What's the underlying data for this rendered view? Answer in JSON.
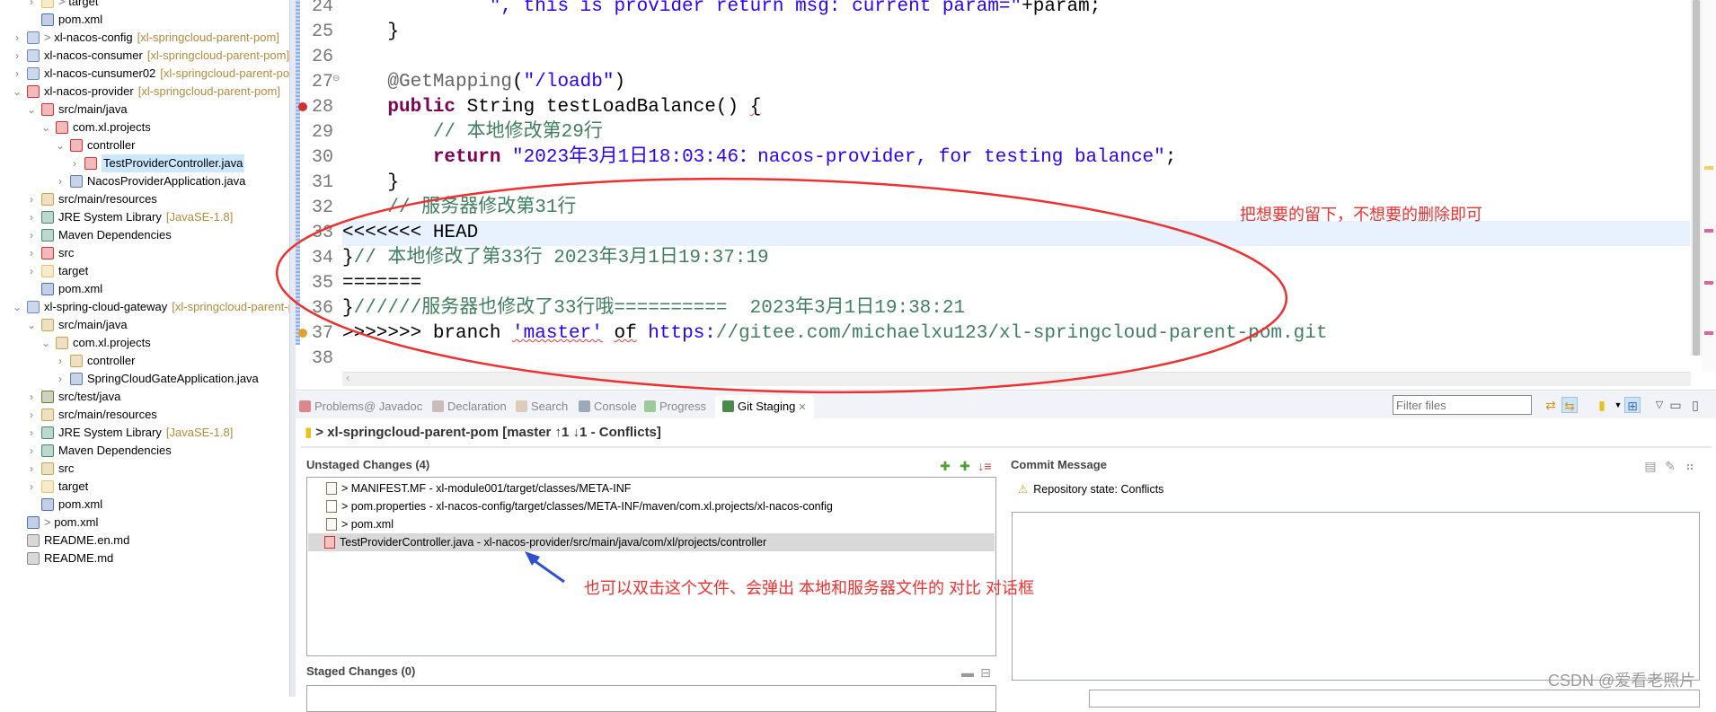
{
  "explorer": {
    "rows": [
      {
        "label": "target",
        "prefix": "> ",
        "level": 2,
        "chevron": "closed",
        "icon": "folder-icon",
        "iconColor": "#e6c36a"
      },
      {
        "label": "pom.xml",
        "level": 2,
        "chevron": null,
        "icon": "maven-file-icon",
        "iconColor": "#4a6fb5"
      },
      {
        "label": "xl-nacos-config",
        "prefix": "> ",
        "deco": "[xl-springcloud-parent-pom]",
        "level": 1,
        "chevron": "closed",
        "icon": "maven-project-icon",
        "iconColor": "#6a8ac8"
      },
      {
        "label": "xl-nacos-consumer",
        "deco": "[xl-springcloud-parent-pom]",
        "level": 1,
        "chevron": "closed",
        "icon": "maven-project-icon",
        "iconColor": "#6a8ac8"
      },
      {
        "label": "xl-nacos-cunsumer02",
        "deco": "[xl-springcloud-parent-pom]",
        "level": 1,
        "chevron": "closed",
        "icon": "maven-project-icon",
        "iconColor": "#6a8ac8"
      },
      {
        "label": "xl-nacos-provider",
        "deco": "[xl-springcloud-parent-pom]",
        "level": 1,
        "chevron": "open",
        "icon": "conflict-project-icon",
        "iconColor": "#d83030"
      },
      {
        "label": "src/main/java",
        "level": 2,
        "chevron": "open",
        "icon": "conflict-package-icon",
        "iconColor": "#d83030"
      },
      {
        "label": "com.xl.projects",
        "level": 3,
        "chevron": "open",
        "icon": "conflict-package-icon",
        "iconColor": "#d83030"
      },
      {
        "label": "controller",
        "level": 4,
        "chevron": "open",
        "icon": "conflict-package-icon",
        "iconColor": "#d83030"
      },
      {
        "label": "TestProviderController.java",
        "level": 5,
        "chevron": "closed",
        "icon": "conflict-java-file-icon",
        "iconColor": "#d83030",
        "selected": true
      },
      {
        "label": "NacosProviderApplication.java",
        "level": 4,
        "chevron": "closed",
        "icon": "java-file-icon",
        "iconColor": "#5a7ab8"
      },
      {
        "label": "src/main/resources",
        "level": 2,
        "chevron": "closed",
        "icon": "source-folder-icon",
        "iconColor": "#c9a44a"
      },
      {
        "label": "JRE System Library",
        "deco": "[JavaSE-1.8]",
        "level": 2,
        "chevron": "closed",
        "icon": "library-icon",
        "iconColor": "#3f8a6a"
      },
      {
        "label": "Maven Dependencies",
        "level": 2,
        "chevron": "closed",
        "icon": "library-icon",
        "iconColor": "#3f8a6a"
      },
      {
        "label": "src",
        "level": 2,
        "chevron": "closed",
        "icon": "conflict-folder-icon",
        "iconColor": "#d83030"
      },
      {
        "label": "target",
        "level": 2,
        "chevron": "closed",
        "icon": "folder-icon",
        "iconColor": "#e6c36a"
      },
      {
        "label": "pom.xml",
        "level": 2,
        "chevron": null,
        "icon": "maven-file-icon",
        "iconColor": "#4a6fb5"
      },
      {
        "label": "xl-spring-cloud-gateway",
        "deco": "[xl-springcloud-parent-pom]",
        "level": 1,
        "chevron": "open",
        "icon": "maven-project-icon",
        "iconColor": "#6a8ac8"
      },
      {
        "label": "src/main/java",
        "level": 2,
        "chevron": "open",
        "icon": "source-folder-icon",
        "iconColor": "#c9a44a"
      },
      {
        "label": "com.xl.projects",
        "level": 3,
        "chevron": "open",
        "icon": "package-icon",
        "iconColor": "#c9a44a"
      },
      {
        "label": "controller",
        "level": 4,
        "chevron": "closed",
        "icon": "package-icon",
        "iconColor": "#c9a44a"
      },
      {
        "label": "SpringCloudGateApplication.java",
        "level": 4,
        "chevron": "closed",
        "icon": "java-file-icon",
        "iconColor": "#5a7ab8"
      },
      {
        "label": "src/test/java",
        "level": 2,
        "chevron": "closed",
        "icon": "source-folder-icon",
        "iconColor": "#6a7a3a"
      },
      {
        "label": "src/main/resources",
        "level": 2,
        "chevron": "closed",
        "icon": "source-folder-icon",
        "iconColor": "#c9a44a"
      },
      {
        "label": "JRE System Library",
        "deco": "[JavaSE-1.8]",
        "level": 2,
        "chevron": "closed",
        "icon": "library-icon",
        "iconColor": "#3f8a6a"
      },
      {
        "label": "Maven Dependencies",
        "level": 2,
        "chevron": "closed",
        "icon": "library-icon",
        "iconColor": "#3f8a6a"
      },
      {
        "label": "src",
        "level": 2,
        "chevron": "closed",
        "icon": "folder-icon",
        "iconColor": "#c9a44a"
      },
      {
        "label": "target",
        "level": 2,
        "chevron": "closed",
        "icon": "folder-icon",
        "iconColor": "#e6c36a"
      },
      {
        "label": "pom.xml",
        "level": 2,
        "chevron": null,
        "icon": "maven-file-icon",
        "iconColor": "#4a6fb5"
      },
      {
        "label": "pom.xml",
        "prefix": "> ",
        "level": 1,
        "chevron": null,
        "icon": "maven-file-icon",
        "iconColor": "#4a6fb5"
      },
      {
        "label": "README.en.md",
        "level": 1,
        "chevron": null,
        "icon": "text-file-icon",
        "iconColor": "#8a8a8a"
      },
      {
        "label": "README.md",
        "level": 1,
        "chevron": null,
        "icon": "text-file-icon",
        "iconColor": "#8a8a8a"
      }
    ]
  },
  "editor": {
    "current_line": 33,
    "lines": [
      {
        "n": "24",
        "segs": [
          {
            "t": "             \", this is provider return msg: current param=\"",
            "c": "s"
          },
          {
            "t": "+param;",
            "c": "p"
          }
        ]
      },
      {
        "n": "25",
        "segs": [
          {
            "t": "    }",
            "c": "p"
          }
        ]
      },
      {
        "n": "26",
        "segs": []
      },
      {
        "n": "27",
        "fold": true,
        "segs": [
          {
            "t": "    @GetMapping",
            "c": "a"
          },
          {
            "t": "(",
            "c": "p"
          },
          {
            "t": "\"/loadb\"",
            "c": "s"
          },
          {
            "t": ")",
            "c": "p"
          }
        ]
      },
      {
        "n": "28",
        "error": true,
        "segs": [
          {
            "t": "    ",
            "c": "p"
          },
          {
            "t": "public",
            "c": "k"
          },
          {
            "t": " String testLoadBalance() ",
            "c": "p"
          },
          {
            "t": "{",
            "c": "p",
            "sq": true
          }
        ]
      },
      {
        "n": "29",
        "segs": [
          {
            "t": "        // 本地修改第29行",
            "c": "c"
          }
        ]
      },
      {
        "n": "30",
        "segs": [
          {
            "t": "        ",
            "c": "p"
          },
          {
            "t": "return",
            "c": "k"
          },
          {
            "t": " \"2023年3月1日18:03:46：nacos-provider, for testing balance\"",
            "c": "s"
          },
          {
            "t": ";",
            "c": "p"
          }
        ]
      },
      {
        "n": "31",
        "segs": [
          {
            "t": "    }",
            "c": "p"
          }
        ]
      },
      {
        "n": "32",
        "segs": [
          {
            "t": "    // 服务器修改第31行",
            "c": "c"
          }
        ]
      },
      {
        "n": "33",
        "segs": [
          {
            "t": "<<<<<<< HEAD",
            "c": "p"
          }
        ]
      },
      {
        "n": "34",
        "segs": [
          {
            "t": "}",
            "c": "p"
          },
          {
            "t": "// 本地修改了第33行 2023年3月1日19:37:19",
            "c": "c"
          }
        ]
      },
      {
        "n": "35",
        "segs": [
          {
            "t": "=======",
            "c": "p"
          }
        ]
      },
      {
        "n": "36",
        "segs": [
          {
            "t": "}",
            "c": "p"
          },
          {
            "t": "//////服务器也修改了33行哦==========  2023年3月1日19:38:21",
            "c": "c"
          }
        ]
      },
      {
        "n": "37",
        "warning": true,
        "segs": [
          {
            "t": ">>>>>>> branch ",
            "c": "p"
          },
          {
            "t": "'master'",
            "c": "s",
            "sq": true
          },
          {
            "t": " ",
            "c": "p"
          },
          {
            "t": "of",
            "c": "p",
            "sq": true
          },
          {
            "t": " ",
            "c": "p"
          },
          {
            "t": "https:",
            "c": "s"
          },
          {
            "t": "//gitee.com/michaelxu123/xl-springcloud-parent-pom.git",
            "c": "c"
          }
        ]
      },
      {
        "n": "38",
        "segs": []
      }
    ]
  },
  "panel": {
    "tabs": [
      {
        "label": "Problems",
        "icon": "problems-icon",
        "color": "#d88"
      },
      {
        "label": "@ Javadoc",
        "icon": "javadoc-icon",
        "color": null
      },
      {
        "label": "Declaration",
        "icon": "declaration-icon",
        "color": "#cbb"
      },
      {
        "label": "Search",
        "icon": "search-icon",
        "color": "#dcb"
      },
      {
        "label": "Console",
        "icon": "console-icon",
        "color": "#9ab"
      },
      {
        "label": "Progress",
        "icon": "progress-icon",
        "color": "#9c9"
      },
      {
        "label": "Git Staging",
        "icon": "git-staging-icon",
        "color": "#4a8a4a",
        "active": true
      }
    ],
    "filter_placeholder": "Filter files",
    "repo_title": "> xl-springcloud-parent-pom [master ↑1 ↓1 - Conflicts]",
    "unstaged": {
      "title": "Unstaged Changes (4)",
      "items": [
        {
          "label": "> MANIFEST.MF - xl-module001/target/classes/META-INF",
          "icon": "text-file-icon"
        },
        {
          "label": "> pom.properties - xl-nacos-config/target/classes/META-INF/maven/com.xl.projects/xl-nacos-config",
          "icon": "text-file-icon"
        },
        {
          "label": "> pom.xml",
          "icon": "maven-file-icon"
        },
        {
          "label": "TestProviderController.java - xl-nacos-provider/src/main/java/com/xl/projects/controller",
          "icon": "conflict-java-file-icon",
          "selected": true
        }
      ]
    },
    "staged": {
      "title": "Staged Changes (0)"
    },
    "commit": {
      "title": "Commit Message",
      "repo_state": "Repository state: Conflicts"
    }
  },
  "annotations": {
    "keep_note": "把想要的留下，不想要的删除即可",
    "dblclick_note": "也可以双击这个文件、会弹出 本地和服务器文件的 对比  对话框",
    "watermark": "CSDN @爱看老照片",
    "ellipse_color": "#f03030",
    "arrow_color": "#3050d0"
  }
}
